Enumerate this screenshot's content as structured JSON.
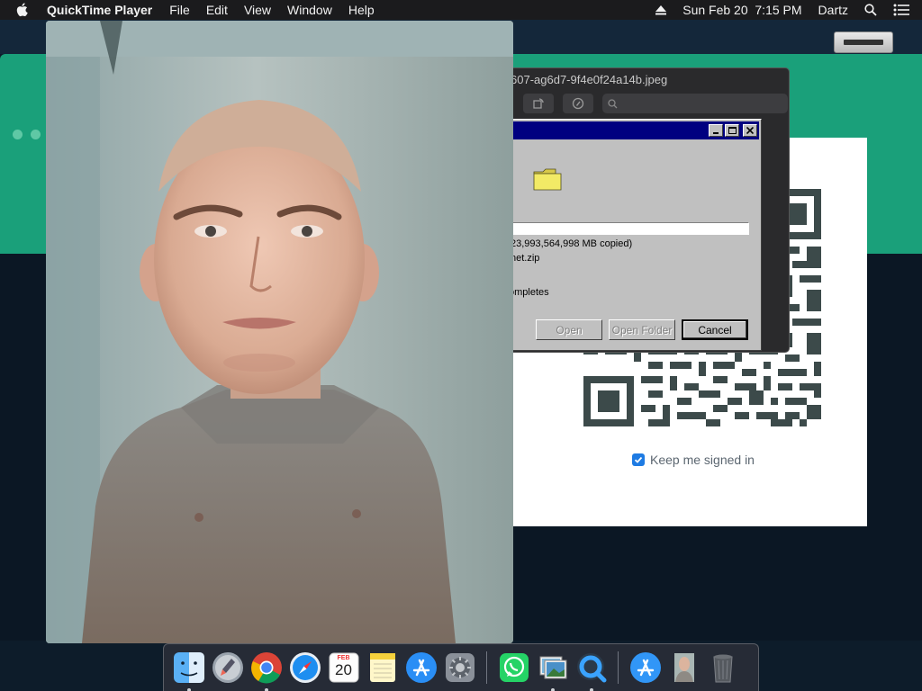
{
  "menubar": {
    "app_name": "QuickTime Player",
    "menus": [
      "File",
      "Edit",
      "View",
      "Window",
      "Help"
    ],
    "datetime": "Sun Feb 20  7:15 PM",
    "user": "Dartz"
  },
  "preview_window": {
    "title": "607-ag6d7-9f4e0f24a14b.jpeg"
  },
  "copy_dialog": {
    "copied_text": "23,993,564,998 MB copied)",
    "file_text": "net.zip",
    "close_when_text": "ompletes",
    "buttons": {
      "open": "Open",
      "open_folder": "Open Folder",
      "cancel": "Cancel"
    },
    "progress_fraction": 0
  },
  "login_card": {
    "keep_signed_in": "Keep me signed in",
    "keep_signed_in_checked": true
  },
  "dock": {
    "calendar_month": "FEB",
    "calendar_day": "20",
    "items": [
      "finder",
      "launchpad",
      "chrome",
      "safari",
      "calendar",
      "notes",
      "app-store",
      "system-preferences",
      "whatsapp",
      "preview",
      "quicktime",
      "app-store-downloads",
      "photo-thumbnail",
      "trash"
    ]
  },
  "colors": {
    "menubar_bg": "#1b1b1d",
    "accent_green": "#1aa07a",
    "win98_title": "#000080",
    "checkbox_blue": "#1e7be3"
  }
}
